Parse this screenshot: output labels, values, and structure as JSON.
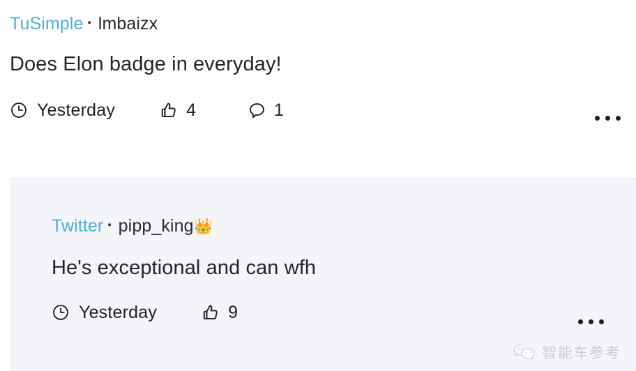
{
  "theme": {
    "page_background": "#ffffff",
    "reply_background": "#f4f5f9",
    "link_color": "#4fb0d4",
    "text_color": "#242424",
    "watermark_color": "#c9c9cf"
  },
  "post": {
    "company": "TuSimple",
    "separator": "▪",
    "username": "lmbaizx",
    "body": "Does Elon badge in everyday!",
    "timestamp": "Yesterday",
    "likes": "4",
    "comments": "1",
    "icons": {
      "clock": "clock-icon",
      "like": "thumbs-up-icon",
      "comment": "comment-bubble-icon",
      "overflow": "more-options-icon"
    }
  },
  "reply": {
    "company": "Twitter",
    "separator": "▪",
    "username": "pipp_king",
    "username_emoji": "👑",
    "body": "He's exceptional and can wfh",
    "timestamp": "Yesterday",
    "likes": "9",
    "icons": {
      "clock": "clock-icon",
      "like": "thumbs-up-icon",
      "overflow": "more-options-icon"
    }
  },
  "watermark": {
    "text": "智能车参考",
    "logo": "wechat-logo-icon"
  }
}
